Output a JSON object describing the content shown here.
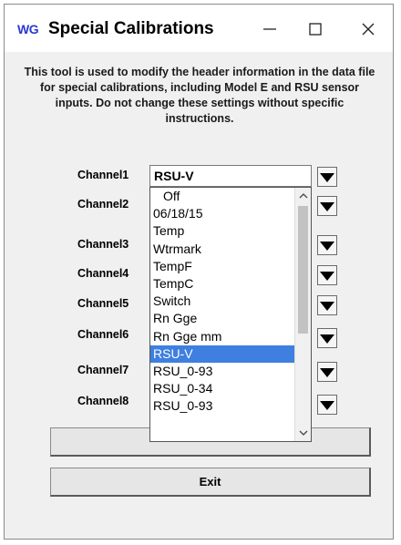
{
  "window": {
    "logo": "WG",
    "title": "Special Calibrations"
  },
  "description": "This tool is used to modify the header information in the data file for special calibrations, including Model E and RSU sensor inputs.  Do not change these settings without specific instructions.",
  "channels": [
    {
      "label": "Channel1",
      "value": "RSU-V"
    },
    {
      "label": "Channel2",
      "value": ""
    },
    {
      "label": "Channel3",
      "value": ""
    },
    {
      "label": "Channel4",
      "value": ""
    },
    {
      "label": "Channel5",
      "value": ""
    },
    {
      "label": "Channel6",
      "value": ""
    },
    {
      "label": "Channel7",
      "value": ""
    },
    {
      "label": "Channel8",
      "value": ""
    }
  ],
  "dropdown": {
    "options": [
      "Off",
      "06/18/15",
      "Temp",
      "Wtrmark",
      "TempF",
      "TempC",
      "Switch",
      "Rn Gge",
      "Rn Gge mm",
      "RSU-V",
      "RSU_0-93",
      "RSU_0-34",
      "RSU_0-93"
    ],
    "selected_index": 9
  },
  "buttons": {
    "blank_label": "",
    "exit_label": "Exit"
  },
  "icons": {
    "minimize": "minimize-icon",
    "maximize": "maximize-icon",
    "close": "close-icon",
    "dropdown": "triangle-down-icon",
    "scroll_up": "chevron-up-icon",
    "scroll_down": "chevron-down-icon"
  },
  "colors": {
    "selection": "#3f7fe0",
    "logo": "#2a3bd0"
  }
}
